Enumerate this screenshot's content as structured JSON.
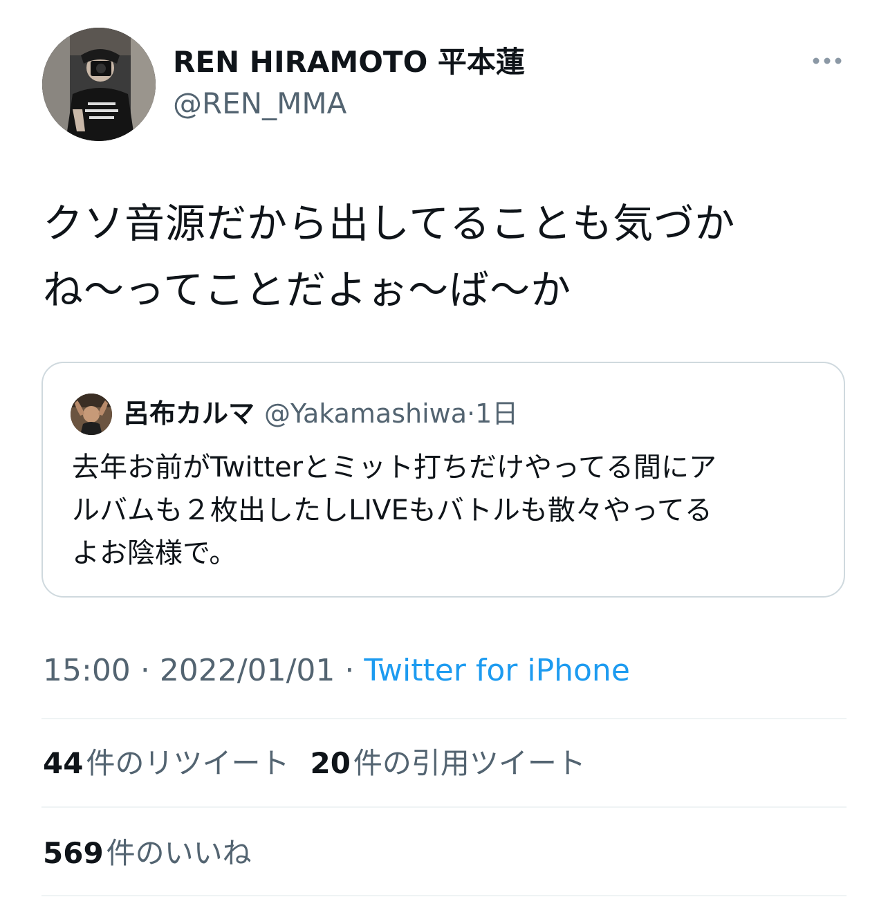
{
  "author": {
    "display_name": "REN HIRAMOTO 平本蓮",
    "handle": "@REN_MMA"
  },
  "more_icon": "more-horizontal-icon",
  "tweet": {
    "text": "クソ音源だから出してることも気づか\nね〜ってことだよぉ〜ば〜か"
  },
  "quote": {
    "name": "呂布カルマ",
    "handle": "@Yakamashiwa",
    "separator": "·",
    "time": "1日",
    "text": "去年お前がTwitterとミット打ちだけやってる間にア\nルバムも２枚出したしLIVEもバトルも散々やってる\nよお陰様で。"
  },
  "meta": {
    "time": "15:00",
    "separator": "·",
    "date": "2022/01/01",
    "source": "Twitter for iPhone"
  },
  "stats": {
    "retweets_count": "44",
    "retweets_label": "件のリツイート",
    "quotes_count": "20",
    "quotes_label": "件の引用ツイート",
    "likes_count": "569",
    "likes_label": "件のいいね"
  },
  "colors": {
    "text_primary": "#0f1419",
    "text_secondary": "#536471",
    "link": "#1d9bf0",
    "border": "#cfd9de",
    "divider": "#eff3f4"
  }
}
